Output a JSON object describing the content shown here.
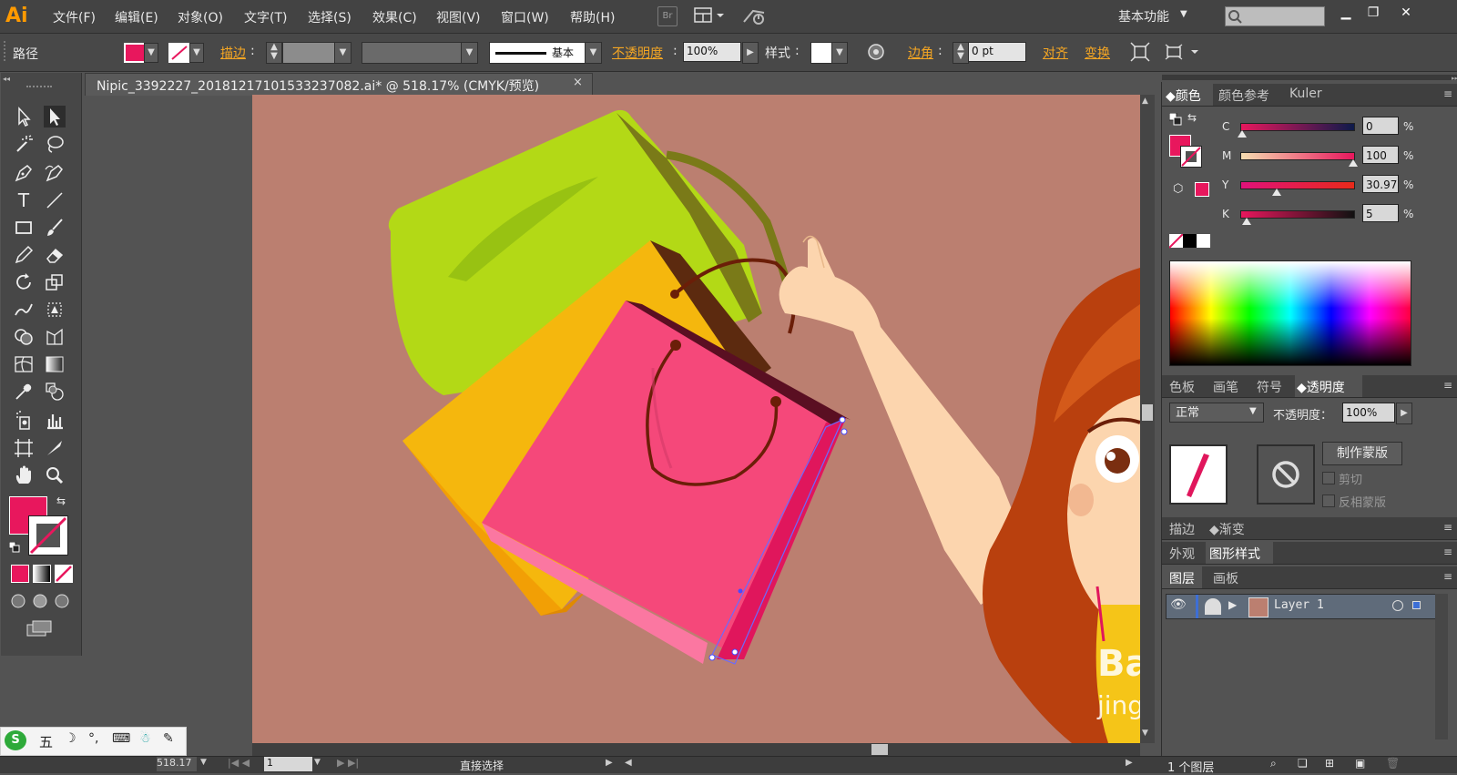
{
  "app": {
    "logo": "Ai"
  },
  "menu": [
    "文件(F)",
    "编辑(E)",
    "对象(O)",
    "文字(T)",
    "选择(S)",
    "效果(C)",
    "视图(V)",
    "窗口(W)",
    "帮助(H)"
  ],
  "bridge_label": "Br",
  "workspace": {
    "label": "基本功能"
  },
  "control": {
    "selection_type": "路径",
    "fill_color": "#e8175d",
    "stroke_label": "描边",
    "brush_label": "基本",
    "opacity_label": "不透明度",
    "opacity_value": "100%",
    "style_label": "样式",
    "corner_label": "边角",
    "corner_value": "0 pt",
    "align_label": "对齐",
    "transform_label": "变换"
  },
  "document": {
    "tab_title": "Nipic_3392227_20181217101533237082.ai* @ 518.17% (CMYK/预览)",
    "close": "×"
  },
  "toolbox": {
    "fill_color": "#e8175d",
    "tools": [
      "selection-tool",
      "direct-selection-tool",
      "magic-wand-tool",
      "lasso-tool",
      "pen-tool",
      "curvature-pen-tool",
      "type-tool",
      "line-segment-tool",
      "rectangle-tool",
      "paintbrush-tool",
      "pencil-tool",
      "eraser-tool",
      "rotate-tool",
      "scale-tool",
      "warp-tool",
      "free-transform-tool",
      "shape-builder-tool",
      "perspective-grid-tool",
      "mesh-tool",
      "gradient-tool",
      "eyedropper-tool",
      "blend-tool",
      "symbol-sprayer-tool",
      "column-graph-tool",
      "artboard-tool",
      "slice-tool",
      "hand-tool",
      "zoom-tool"
    ]
  },
  "status": {
    "zoom": "518.17",
    "page": "1",
    "tool_name": "直接选择",
    "layer_count": "1 个图层"
  },
  "color_panel": {
    "tabs": [
      "颜色",
      "颜色参考",
      "Kuler"
    ],
    "channels": [
      {
        "label": "C",
        "value": "0"
      },
      {
        "label": "M",
        "value": "100"
      },
      {
        "label": "Y",
        "value": "30.97"
      },
      {
        "label": "K",
        "value": "5"
      }
    ],
    "percent": "%",
    "swatch_color": "#e8175d"
  },
  "transparency_panel": {
    "tabs": [
      "色板",
      "画笔",
      "符号",
      "透明度"
    ],
    "blend_mode": "正常",
    "opacity_label": "不透明度：",
    "opacity_value": "100%",
    "make_mask": "制作蒙版",
    "clip": "剪切",
    "invert_mask": "反相蒙版"
  },
  "stroke_panel": {
    "tabs": [
      "描边",
      "渐变"
    ]
  },
  "appearance_panel": {
    "tabs": [
      "外观",
      "图形样式"
    ]
  },
  "layers_panel": {
    "tabs": [
      "图层",
      "画板"
    ],
    "layer_name": "Layer 1"
  },
  "ime": {
    "label": "五"
  },
  "watermark": {
    "line1": "Ba",
    "line2": "jing"
  }
}
